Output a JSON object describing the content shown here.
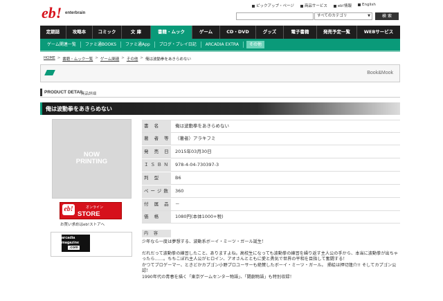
{
  "header": {
    "logo_mark": "eb!",
    "logo_text": "enterbrain",
    "top_links": [
      "ピックアップ・ページ",
      "商品サービス",
      "eb!情報",
      "English"
    ],
    "search": {
      "placeholder": "",
      "category_selected": "すべてのカテゴリ",
      "button_label": "検 索"
    }
  },
  "main_nav": {
    "items": [
      "定期誌",
      "攻略本",
      "コミック",
      "文 庫",
      "書籍・ムック",
      "ゲーム",
      "CD・DVD",
      "グッズ",
      "電子書籍",
      "発売予定一覧",
      "WEBサービス"
    ],
    "active_index": 4
  },
  "sub_nav": {
    "items": [
      "ゲーム関連一覧",
      "ファミ通BOOKS",
      "ファミ通App",
      "ブログ・プレイ日記",
      "ARCADIA EXTRA",
      "その他"
    ],
    "active_index": 5
  },
  "breadcrumb": [
    "HOME",
    "書籍・ムック一覧",
    "ゲーム関連",
    "その他",
    "俺は波動拳をあきらめない"
  ],
  "category_box": {
    "label": "Book&Mook"
  },
  "product_detail": {
    "title": "PRODUCT DETAIL",
    "subtitle": "商品詳細"
  },
  "book": {
    "title": "俺は波動拳をあきらめない",
    "cover_placeholder": [
      "NOW",
      "PRINTING"
    ],
    "details": [
      {
        "label": "書 名",
        "value": "俺は波動拳をあきらめない"
      },
      {
        "label": "著 者 等",
        "value": "（著者）アラキフミ"
      },
      {
        "label": "発 売 日",
        "value": "2015年03月30日"
      },
      {
        "label": "ＩＳＢＮ",
        "value": "978-4-04-730397-3"
      },
      {
        "label": "判 型",
        "value": "B6"
      },
      {
        "label": "ページ数",
        "value": "360"
      },
      {
        "label": "付 属 品",
        "value": "－"
      },
      {
        "label": "価 格",
        "value": "1080円(本体1000+税)"
      }
    ],
    "content_label": "内 容",
    "content": [
      "少年なら一度は夢想する、波動系ボーイ・ミーツ・ガール誕生！",
      "だれだって波動拳の練習したこと、ありますよね。高校生になっても波動拳の練習を繰り返す主人公の手から、本当に波動拳が出ちゃったら……。ちちこぼれ主人公がヒロイン、アオさんとともに愛と勇気で世界の平和を目指して奮闘する！",
      "かつてブロゲーマー、ときどかカプゴン小野プロユーサーも絶賛したボーイ・ミーツ・ガール。 挿絵は押切蓮介!! そしてカプゴン公認！",
      "1990年代の青春を描く「東京ゲームセンター物語」、「闘劇物語」も特別収録！"
    ]
  },
  "store": {
    "online_label": "オンライン",
    "store_label": "STORE",
    "caption": "お買い求めはeb!ストアへ"
  },
  "arcadia_banner": {
    "lines": [
      "arcadia",
      "magazine",
      ".com"
    ]
  },
  "colors": {
    "accent": "#0a9a79",
    "nav_bg": "#1e1e1e",
    "store_red": "#d6111b"
  }
}
